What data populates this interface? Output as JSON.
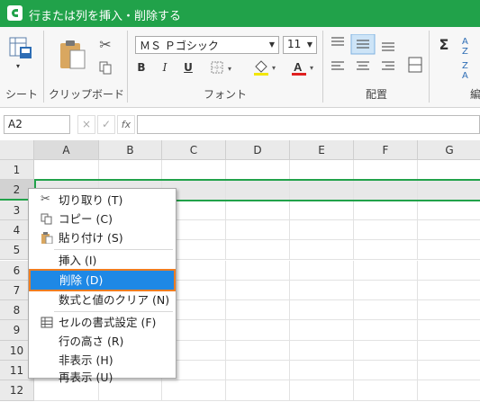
{
  "window": {
    "title": "行または列を挿入・削除する"
  },
  "ribbon": {
    "groups": [
      "シート",
      "クリップボード",
      "フォント",
      "配置",
      "編"
    ],
    "font_name": "ＭＳ Ｐゴシック",
    "font_size": "11",
    "bold": "B",
    "italic": "I",
    "underline": "U",
    "font_color_letter": "A",
    "sigma": "Σ",
    "accent_color": "#21a24a"
  },
  "formula_bar": {
    "name_box": "A2",
    "fx": "fx",
    "cancel": "×",
    "enter": "✓",
    "formula": ""
  },
  "grid": {
    "columns": [
      "A",
      "B",
      "C",
      "D",
      "E",
      "F",
      "G"
    ],
    "rows": [
      "1",
      "2",
      "3",
      "4",
      "5",
      "6",
      "7",
      "8",
      "9",
      "10",
      "11",
      "12"
    ],
    "selected_row": "2"
  },
  "context_menu": {
    "items": [
      {
        "label": "切り取り (T)",
        "icon": "scissors-icon"
      },
      {
        "label": "コピー (C)",
        "icon": "copy-icon"
      },
      {
        "label": "貼り付け (S)",
        "icon": "paste-icon"
      },
      {
        "label": "挿入 (I)",
        "icon": ""
      },
      {
        "label": "削除 (D)",
        "icon": ""
      },
      {
        "label": "数式と値のクリア (N)",
        "icon": ""
      },
      {
        "label": "セルの書式設定 (F)",
        "icon": "format-cells-icon"
      },
      {
        "label": "行の高さ (R)",
        "icon": ""
      },
      {
        "label": "非表示 (H)",
        "icon": ""
      },
      {
        "label": "再表示 (U)",
        "icon": ""
      }
    ],
    "active_item": "削除 (D)",
    "highlight_color": "#1e88e5",
    "outline_color": "#ee7d22"
  }
}
